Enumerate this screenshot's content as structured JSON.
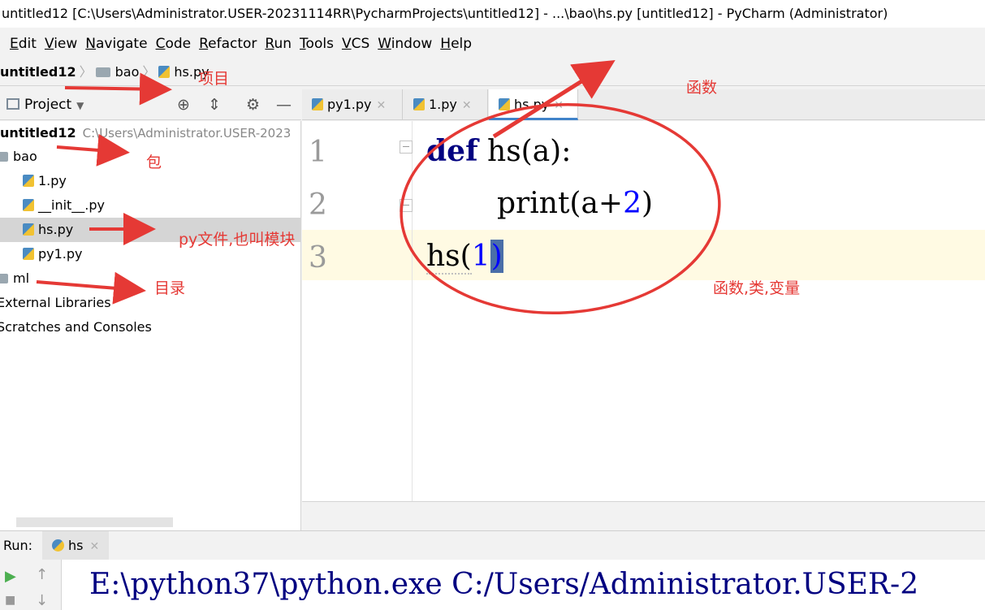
{
  "window": {
    "title": "untitled12 [C:\\Users\\Administrator.USER-20231114RR\\PycharmProjects\\untitled12] - ...\\bao\\hs.py [untitled12] - PyCharm (Administrator)"
  },
  "menu": [
    "Edit",
    "View",
    "Navigate",
    "Code",
    "Refactor",
    "Run",
    "Tools",
    "VCS",
    "Window",
    "Help"
  ],
  "breadcrumb": {
    "project": "untitled12",
    "folder": "bao",
    "file": "hs.py"
  },
  "project_panel": {
    "title": "Project",
    "root": {
      "name": "untitled12",
      "path": "C:\\Users\\Administrator.USER-2023"
    },
    "items": [
      "bao",
      "1.py",
      "__init__.py",
      "hs.py",
      "py1.py",
      "ml",
      "External Libraries",
      "Scratches and Consoles"
    ],
    "selected": "hs.py"
  },
  "tabs": [
    {
      "label": "py1.py",
      "active": false
    },
    {
      "label": "1.py",
      "active": false
    },
    {
      "label": "hs.py",
      "active": true
    }
  ],
  "editor": {
    "line_numbers": [
      "1",
      "2",
      "3"
    ],
    "lines": {
      "l1": {
        "kw": "def",
        "rest": " hs(a):"
      },
      "l2": {
        "pre": "print(a+",
        "num": "2",
        "post": ")"
      },
      "l3": {
        "pre": "hs(",
        "num": "1",
        "post": ")"
      }
    },
    "current_line": 3
  },
  "run_panel": {
    "label": "Run:",
    "tab": "hs",
    "output": "E:\\python37\\python.exe C:/Users/Administrator.USER-2"
  },
  "annotations": {
    "project": "项目",
    "function": "函数",
    "package": "包",
    "module": "py文件,也叫模块",
    "directory": "目录",
    "scope": "函数,类,变量"
  },
  "colors": {
    "annotation": "#e53935",
    "keyword": "#000080",
    "number": "#0000ff",
    "current_line": "#fffae3",
    "selection": "#d5d5d5"
  }
}
